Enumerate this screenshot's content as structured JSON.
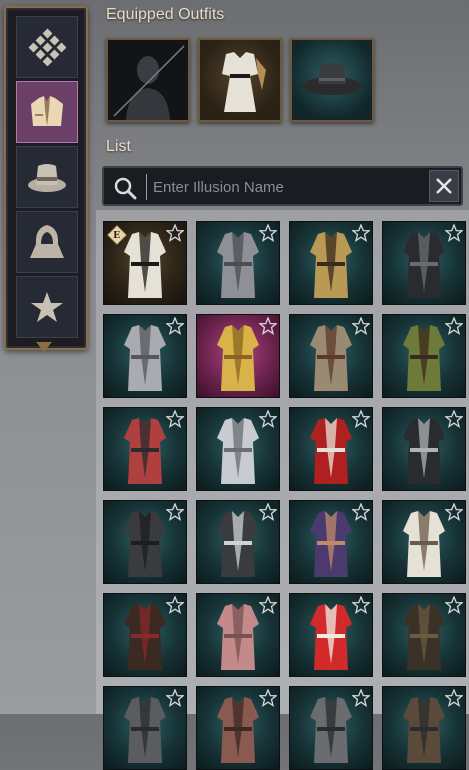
{
  "rail": {
    "items": [
      {
        "name": "rail-item-all",
        "icon": "grid-diamond-icon",
        "active": false
      },
      {
        "name": "rail-item-outfit",
        "icon": "jacket-icon",
        "active": true
      },
      {
        "name": "rail-item-hat",
        "icon": "hat-icon",
        "active": false
      },
      {
        "name": "rail-item-hood",
        "icon": "hood-icon",
        "active": false
      },
      {
        "name": "rail-item-favorites",
        "icon": "star-icon",
        "active": false
      }
    ]
  },
  "equipped": {
    "title": "Equipped Outfits",
    "slots": [
      {
        "name": "equipped-slot-face",
        "icon": "face-disabled-icon"
      },
      {
        "name": "equipped-slot-outfit",
        "icon": "outfit-icon"
      },
      {
        "name": "equipped-slot-hat",
        "icon": "hat-icon"
      }
    ]
  },
  "list": {
    "title": "List",
    "search_placeholder": "Enter Illusion Name",
    "search_value": "",
    "equipped_badge": "E",
    "tiles": [
      {
        "row": 1,
        "col": 1,
        "theme": "gold",
        "equipped": true
      },
      {
        "row": 1,
        "col": 2,
        "theme": "teal",
        "equipped": false
      },
      {
        "row": 1,
        "col": 3,
        "theme": "teal",
        "equipped": false
      },
      {
        "row": 1,
        "col": 4,
        "theme": "teal",
        "equipped": false
      },
      {
        "row": 2,
        "col": 1,
        "theme": "teal",
        "equipped": false
      },
      {
        "row": 2,
        "col": 2,
        "theme": "purple",
        "equipped": false
      },
      {
        "row": 2,
        "col": 3,
        "theme": "teal",
        "equipped": false
      },
      {
        "row": 2,
        "col": 4,
        "theme": "teal",
        "equipped": false
      },
      {
        "row": 3,
        "col": 1,
        "theme": "teal",
        "equipped": false
      },
      {
        "row": 3,
        "col": 2,
        "theme": "teal",
        "equipped": false
      },
      {
        "row": 3,
        "col": 3,
        "theme": "teal",
        "equipped": false
      },
      {
        "row": 3,
        "col": 4,
        "theme": "teal",
        "equipped": false
      },
      {
        "row": 4,
        "col": 1,
        "theme": "teal",
        "equipped": false
      },
      {
        "row": 4,
        "col": 2,
        "theme": "teal",
        "equipped": false
      },
      {
        "row": 4,
        "col": 3,
        "theme": "teal",
        "equipped": false
      },
      {
        "row": 4,
        "col": 4,
        "theme": "teal",
        "equipped": false
      },
      {
        "row": 5,
        "col": 1,
        "theme": "teal",
        "equipped": false
      },
      {
        "row": 5,
        "col": 2,
        "theme": "teal",
        "equipped": false
      },
      {
        "row": 5,
        "col": 3,
        "theme": "teal",
        "equipped": false
      },
      {
        "row": 5,
        "col": 4,
        "theme": "teal",
        "equipped": false
      },
      {
        "row": 6,
        "col": 1,
        "theme": "teal",
        "equipped": false
      },
      {
        "row": 6,
        "col": 2,
        "theme": "teal",
        "equipped": false
      },
      {
        "row": 6,
        "col": 3,
        "theme": "teal",
        "equipped": false
      },
      {
        "row": 6,
        "col": 4,
        "theme": "teal",
        "equipped": false
      }
    ]
  },
  "colors": {
    "accent_gold": "#8c6e45",
    "active_purple": "#6a4068",
    "tile_teal": "#163336",
    "title_text": "#e9dcc2"
  }
}
